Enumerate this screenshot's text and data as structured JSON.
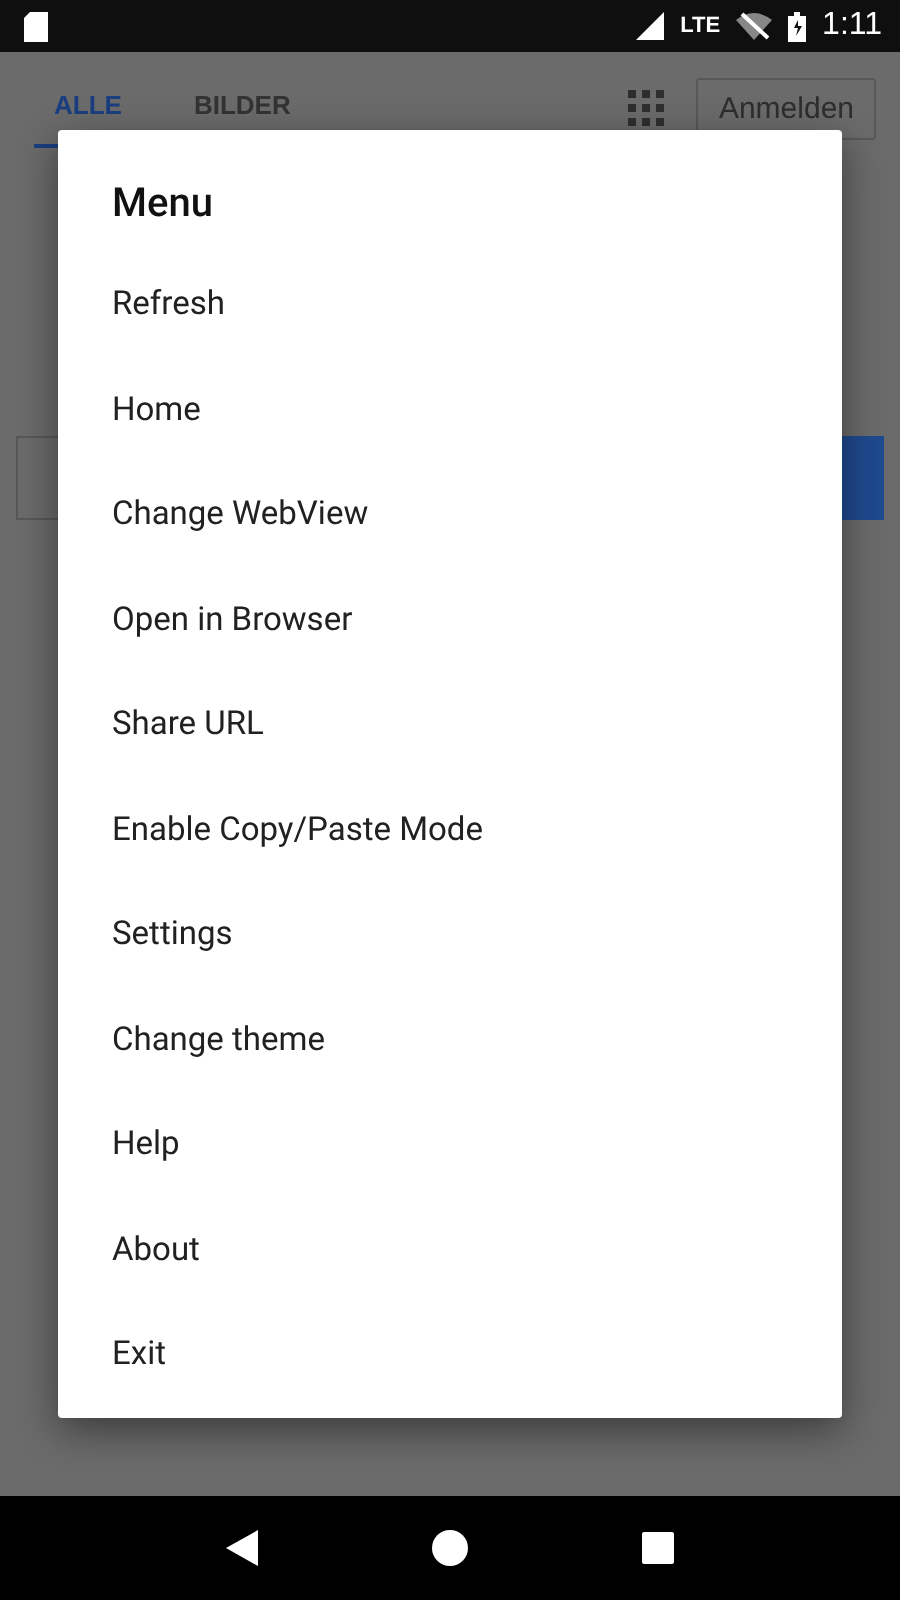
{
  "status_bar": {
    "time": "1:11",
    "network": "LTE"
  },
  "page": {
    "tabs": [
      {
        "label": "ALLE",
        "selected": true
      },
      {
        "label": "BILDER",
        "selected": false
      }
    ],
    "sign_in_button": "Anmelden"
  },
  "dialog": {
    "title": "Menu",
    "items": [
      "Refresh",
      "Home",
      "Change WebView",
      "Open in Browser",
      "Share URL",
      "Enable Copy/Paste Mode",
      "Settings",
      "Change theme",
      "Help",
      "About",
      "Exit"
    ]
  }
}
